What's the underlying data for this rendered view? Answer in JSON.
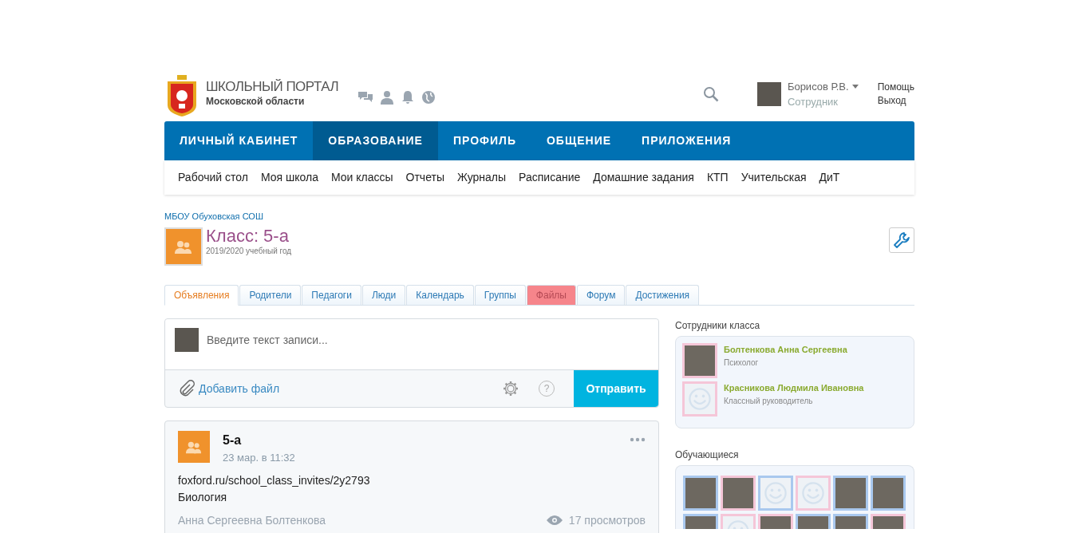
{
  "header": {
    "title": "ШКОЛЬНЫЙ ПОРТАЛ",
    "subtitle": "Московской области",
    "user": {
      "name": "Борисов Р.В.",
      "role": "Сотрудник"
    },
    "links": [
      "Помощь",
      "Выход"
    ]
  },
  "main_nav": [
    {
      "label": "ЛИЧНЫЙ КАБИНЕТ",
      "selected": false
    },
    {
      "label": "ОБРАЗОВАНИЕ",
      "selected": true
    },
    {
      "label": "ПРОФИЛЬ",
      "selected": false
    },
    {
      "label": "ОБЩЕНИЕ",
      "selected": false
    },
    {
      "label": "ПРИЛОЖЕНИЯ",
      "selected": false
    }
  ],
  "sub_nav": [
    "Рабочий стол",
    "Моя школа",
    "Мои классы",
    "Отчеты",
    "Журналы",
    "Расписание",
    "Домашние задания",
    "КТП",
    "Учительская",
    "ДиТ"
  ],
  "breadcrumb": "МБОУ Обуховская СОШ",
  "class_info": {
    "title": "Класс: 5-а",
    "year": "2019/2020 учебный год"
  },
  "tabs": [
    {
      "label": "Объявления",
      "selected": true,
      "highlighted": false
    },
    {
      "label": "Родители",
      "selected": false,
      "highlighted": false
    },
    {
      "label": "Педагоги",
      "selected": false,
      "highlighted": false
    },
    {
      "label": "Люди",
      "selected": false,
      "highlighted": false
    },
    {
      "label": "Календарь",
      "selected": false,
      "highlighted": false
    },
    {
      "label": "Группы",
      "selected": false,
      "highlighted": false
    },
    {
      "label": "Файлы",
      "selected": false,
      "highlighted": true
    },
    {
      "label": "Форум",
      "selected": false,
      "highlighted": false
    },
    {
      "label": "Достижения",
      "selected": false,
      "highlighted": false
    }
  ],
  "composer": {
    "placeholder": "Введите текст записи...",
    "add_file": "Добавить файл",
    "help": "?",
    "submit": "Отправить"
  },
  "post": {
    "author": "5-а",
    "time": "23 мар. в 11:32",
    "lines": [
      "foxford.ru/school_class_invites/2y2793",
      "Биология"
    ],
    "signature": "Анна Сергеевна Болтенкова",
    "views": "17 просмотров"
  },
  "staff": {
    "title": "Сотрудники класса",
    "members": [
      {
        "name": "Болтенкова Анна Сергеевна",
        "role": "Психолог",
        "kind": "photo",
        "color": "#f5c6d8"
      },
      {
        "name": "Красникова Людмила Ивановна",
        "role": "Классный руководитель",
        "kind": "placeholder",
        "color": "#f5c6d8"
      }
    ]
  },
  "students": {
    "title": "Обучающиеся",
    "items": [
      {
        "kind": "photo",
        "color": "#a9c8ee"
      },
      {
        "kind": "photo",
        "color": "#f5c6d8"
      },
      {
        "kind": "placeholder",
        "color": "#a9c8ee"
      },
      {
        "kind": "placeholder",
        "color": "#f5c6d8"
      },
      {
        "kind": "photo",
        "color": "#a9c8ee"
      },
      {
        "kind": "photo",
        "color": "#a9c8ee"
      },
      {
        "kind": "photo",
        "color": "#a9c8ee"
      },
      {
        "kind": "placeholder",
        "color": "#f5c6d8"
      },
      {
        "kind": "photo",
        "color": "#f5c6d8"
      },
      {
        "kind": "photo",
        "color": "#a9c8ee"
      },
      {
        "kind": "photo",
        "color": "#a9c8ee"
      },
      {
        "kind": "photo",
        "color": "#f5c6d8"
      }
    ]
  }
}
